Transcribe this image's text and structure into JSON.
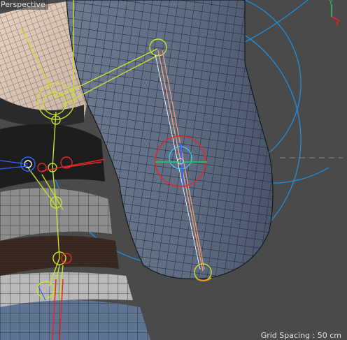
{
  "viewport": {
    "view_name": "Perspective",
    "grid_spacing": "Grid Spacing : 50 cm"
  },
  "axis_gizmo": {
    "labels": [
      "Y",
      "X"
    ]
  },
  "colors": {
    "background": "#4a4a4a",
    "mesh_fill": "#5e6b80",
    "wire": "#1c222b",
    "joint_yellow": "#c8e030",
    "joint_blue": "#2f67ff",
    "joint_red": "#e02a2a",
    "gizmo_blue": "#1f8fe0",
    "bone_salmon": "#f2a27a"
  },
  "icons": [
    "axis-gizmo-icon",
    "rotation-gizmo-icon",
    "joint-icon"
  ]
}
